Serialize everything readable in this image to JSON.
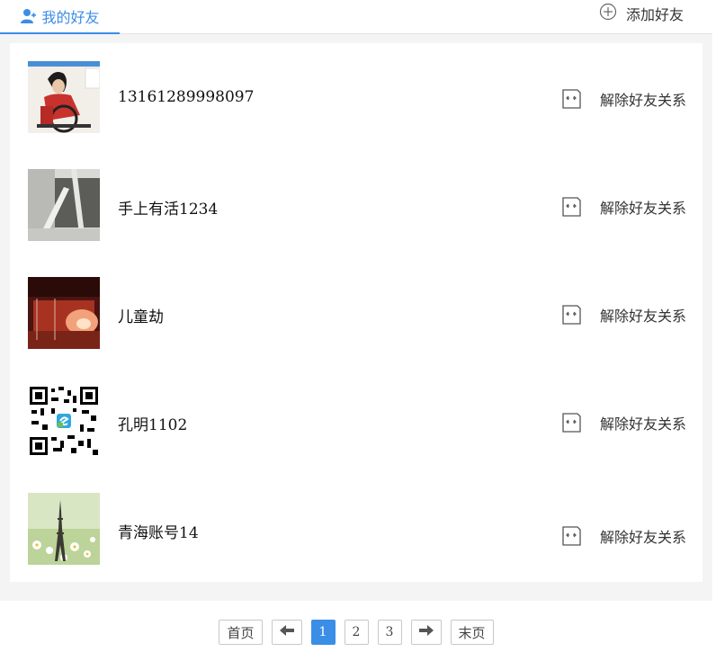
{
  "header": {
    "my_friends_tab": "我的好友",
    "add_friend": "添加好友"
  },
  "colors": {
    "accent": "#3a8ee6",
    "panel_bg": "#f4f4f4"
  },
  "friends": [
    {
      "name": "13161289998097",
      "action": "解除好友关系",
      "avatar": "wheelchair-figure-photo"
    },
    {
      "name": "手上有活1234",
      "action": "解除好友关系",
      "avatar": "interior-grey-photo"
    },
    {
      "name": "儿童劫",
      "action": "解除好友关系",
      "avatar": "red-stage-photo"
    },
    {
      "name": "孔明1102",
      "action": "解除好友关系",
      "avatar": "qr-code-image"
    },
    {
      "name": "青海账号14",
      "action": "解除好友关系",
      "avatar": "eiffel-tower-flowers-photo"
    }
  ],
  "pagination": {
    "first": "首页",
    "last": "末页",
    "pages": [
      "1",
      "2",
      "3"
    ],
    "current": "1"
  }
}
